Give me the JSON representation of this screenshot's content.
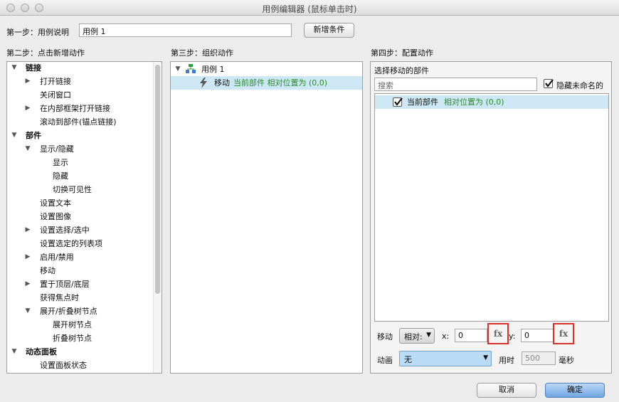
{
  "window": {
    "title": "用例编辑器 (鼠标单击时)"
  },
  "step1": {
    "label": "第一步：用例说明",
    "value": "用例 1",
    "add_condition_label": "新增条件"
  },
  "step2": {
    "label": "第二步：点击新增动作",
    "items": [
      {
        "label": "链接",
        "bold": true
      },
      {
        "label": "打开链接"
      },
      {
        "label": "关闭窗口"
      },
      {
        "label": "在内部框架打开链接"
      },
      {
        "label": "滚动到部件(锚点链接)"
      },
      {
        "label": "部件",
        "bold": true
      },
      {
        "label": "显示/隐藏"
      },
      {
        "label": "显示"
      },
      {
        "label": "隐藏"
      },
      {
        "label": "切换可见性"
      },
      {
        "label": "设置文本"
      },
      {
        "label": "设置图像"
      },
      {
        "label": "设置选择/选中"
      },
      {
        "label": "设置选定的列表项"
      },
      {
        "label": "启用/禁用"
      },
      {
        "label": "移动"
      },
      {
        "label": "置于顶层/底层"
      },
      {
        "label": "获得焦点时"
      },
      {
        "label": "展开/折叠树节点"
      },
      {
        "label": "展开树节点"
      },
      {
        "label": "折叠树节点"
      },
      {
        "label": "动态面板",
        "bold": true
      },
      {
        "label": "设置面板状态"
      }
    ]
  },
  "step3": {
    "label": "第三步：组织动作",
    "case_label": "用例 1",
    "action_verb": "移动",
    "action_detail": "当前部件 相对位置为 (0,0)"
  },
  "step4": {
    "label": "第四步：配置动作",
    "select_label": "选择移动的部件",
    "search_placeholder": "搜索",
    "hide_unnamed_label": "隐藏未命名的",
    "widget_name": "当前部件",
    "widget_detail": "相对位置为 (0,0)",
    "move_label": "移动",
    "move_mode": "相对:",
    "x_label": "x:",
    "x_value": "0",
    "y_label": "y:",
    "y_value": "0",
    "fx_label": "fx",
    "anim_label": "动画",
    "anim_value": "无",
    "time_label": "用时",
    "time_value": "500",
    "ms_label": "毫秒"
  },
  "footer": {
    "cancel_label": "取消",
    "ok_label": "确定"
  },
  "colors": {
    "selection": "#cde8f4",
    "accent_green": "#2a8a2a",
    "highlight_red": "#d9322a"
  }
}
